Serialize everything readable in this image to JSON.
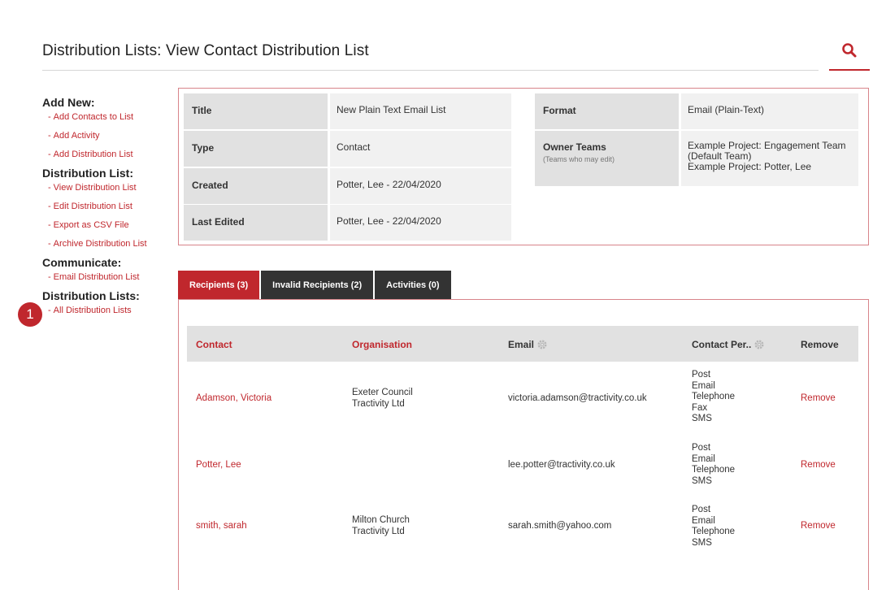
{
  "header": {
    "title": "Distribution Lists: View Contact Distribution List",
    "search_icon": "search-icon"
  },
  "sidebar": {
    "sections": [
      {
        "heading": "Add New:",
        "items": [
          "Add Contacts to List",
          "Add Activity",
          "Add Distribution List"
        ]
      },
      {
        "heading": "Distribution List:",
        "items": [
          "View Distribution List",
          "Edit Distribution List",
          "Export as CSV File",
          "Archive Distribution List"
        ]
      },
      {
        "heading": "Communicate:",
        "items": [
          "Email Distribution List"
        ]
      },
      {
        "heading": "Distribution Lists:",
        "items": [
          "All Distribution Lists"
        ]
      }
    ]
  },
  "callout": {
    "number": "1"
  },
  "details": {
    "title_label": "Title",
    "title_value": "New Plain Text Email List",
    "type_label": "Type",
    "type_value": "Contact",
    "created_label": "Created",
    "created_value": "Potter, Lee - 22/04/2020",
    "edited_label": "Last Edited",
    "edited_value": "Potter, Lee - 22/04/2020",
    "format_label": "Format",
    "format_value": "Email (Plain-Text)",
    "owner_label": "Owner Teams",
    "owner_sub": "(Teams who may edit)",
    "owner_value_1": "Example Project: Engagement Team (Default Team)",
    "owner_value_2": "Example Project: Potter, Lee"
  },
  "tabs": [
    {
      "label": "Recipients (3)",
      "active": true
    },
    {
      "label": "Invalid Recipients (2)",
      "active": false
    },
    {
      "label": "Activities (0)",
      "active": false
    }
  ],
  "table": {
    "headers": {
      "contact": "Contact",
      "organisation": "Organisation",
      "email": "Email",
      "contact_per": "Contact Per..",
      "remove": "Remove"
    },
    "rows": [
      {
        "contact": "Adamson, Victoria",
        "organisation": [
          "Exeter Council",
          "Tractivity Ltd"
        ],
        "email": "victoria.adamson@tractivity.co.uk",
        "methods": [
          "Post",
          "Email",
          "Telephone",
          "Fax",
          "SMS"
        ],
        "remove": "Remove"
      },
      {
        "contact": "Potter, Lee",
        "organisation": [],
        "email": "lee.potter@tractivity.co.uk",
        "methods": [
          "Post",
          "Email",
          "Telephone",
          "SMS"
        ],
        "remove": "Remove"
      },
      {
        "contact": "smith, sarah",
        "organisation": [
          "Milton Church",
          "Tractivity Ltd"
        ],
        "email": "sarah.smith@yahoo.com",
        "methods": [
          "Post",
          "Email",
          "Telephone",
          "SMS"
        ],
        "remove": "Remove"
      }
    ]
  },
  "colors": {
    "accent": "#c0272d",
    "tab_dark": "#333333",
    "label_bg": "#e1e1e1",
    "value_bg": "#f1f1f1"
  }
}
